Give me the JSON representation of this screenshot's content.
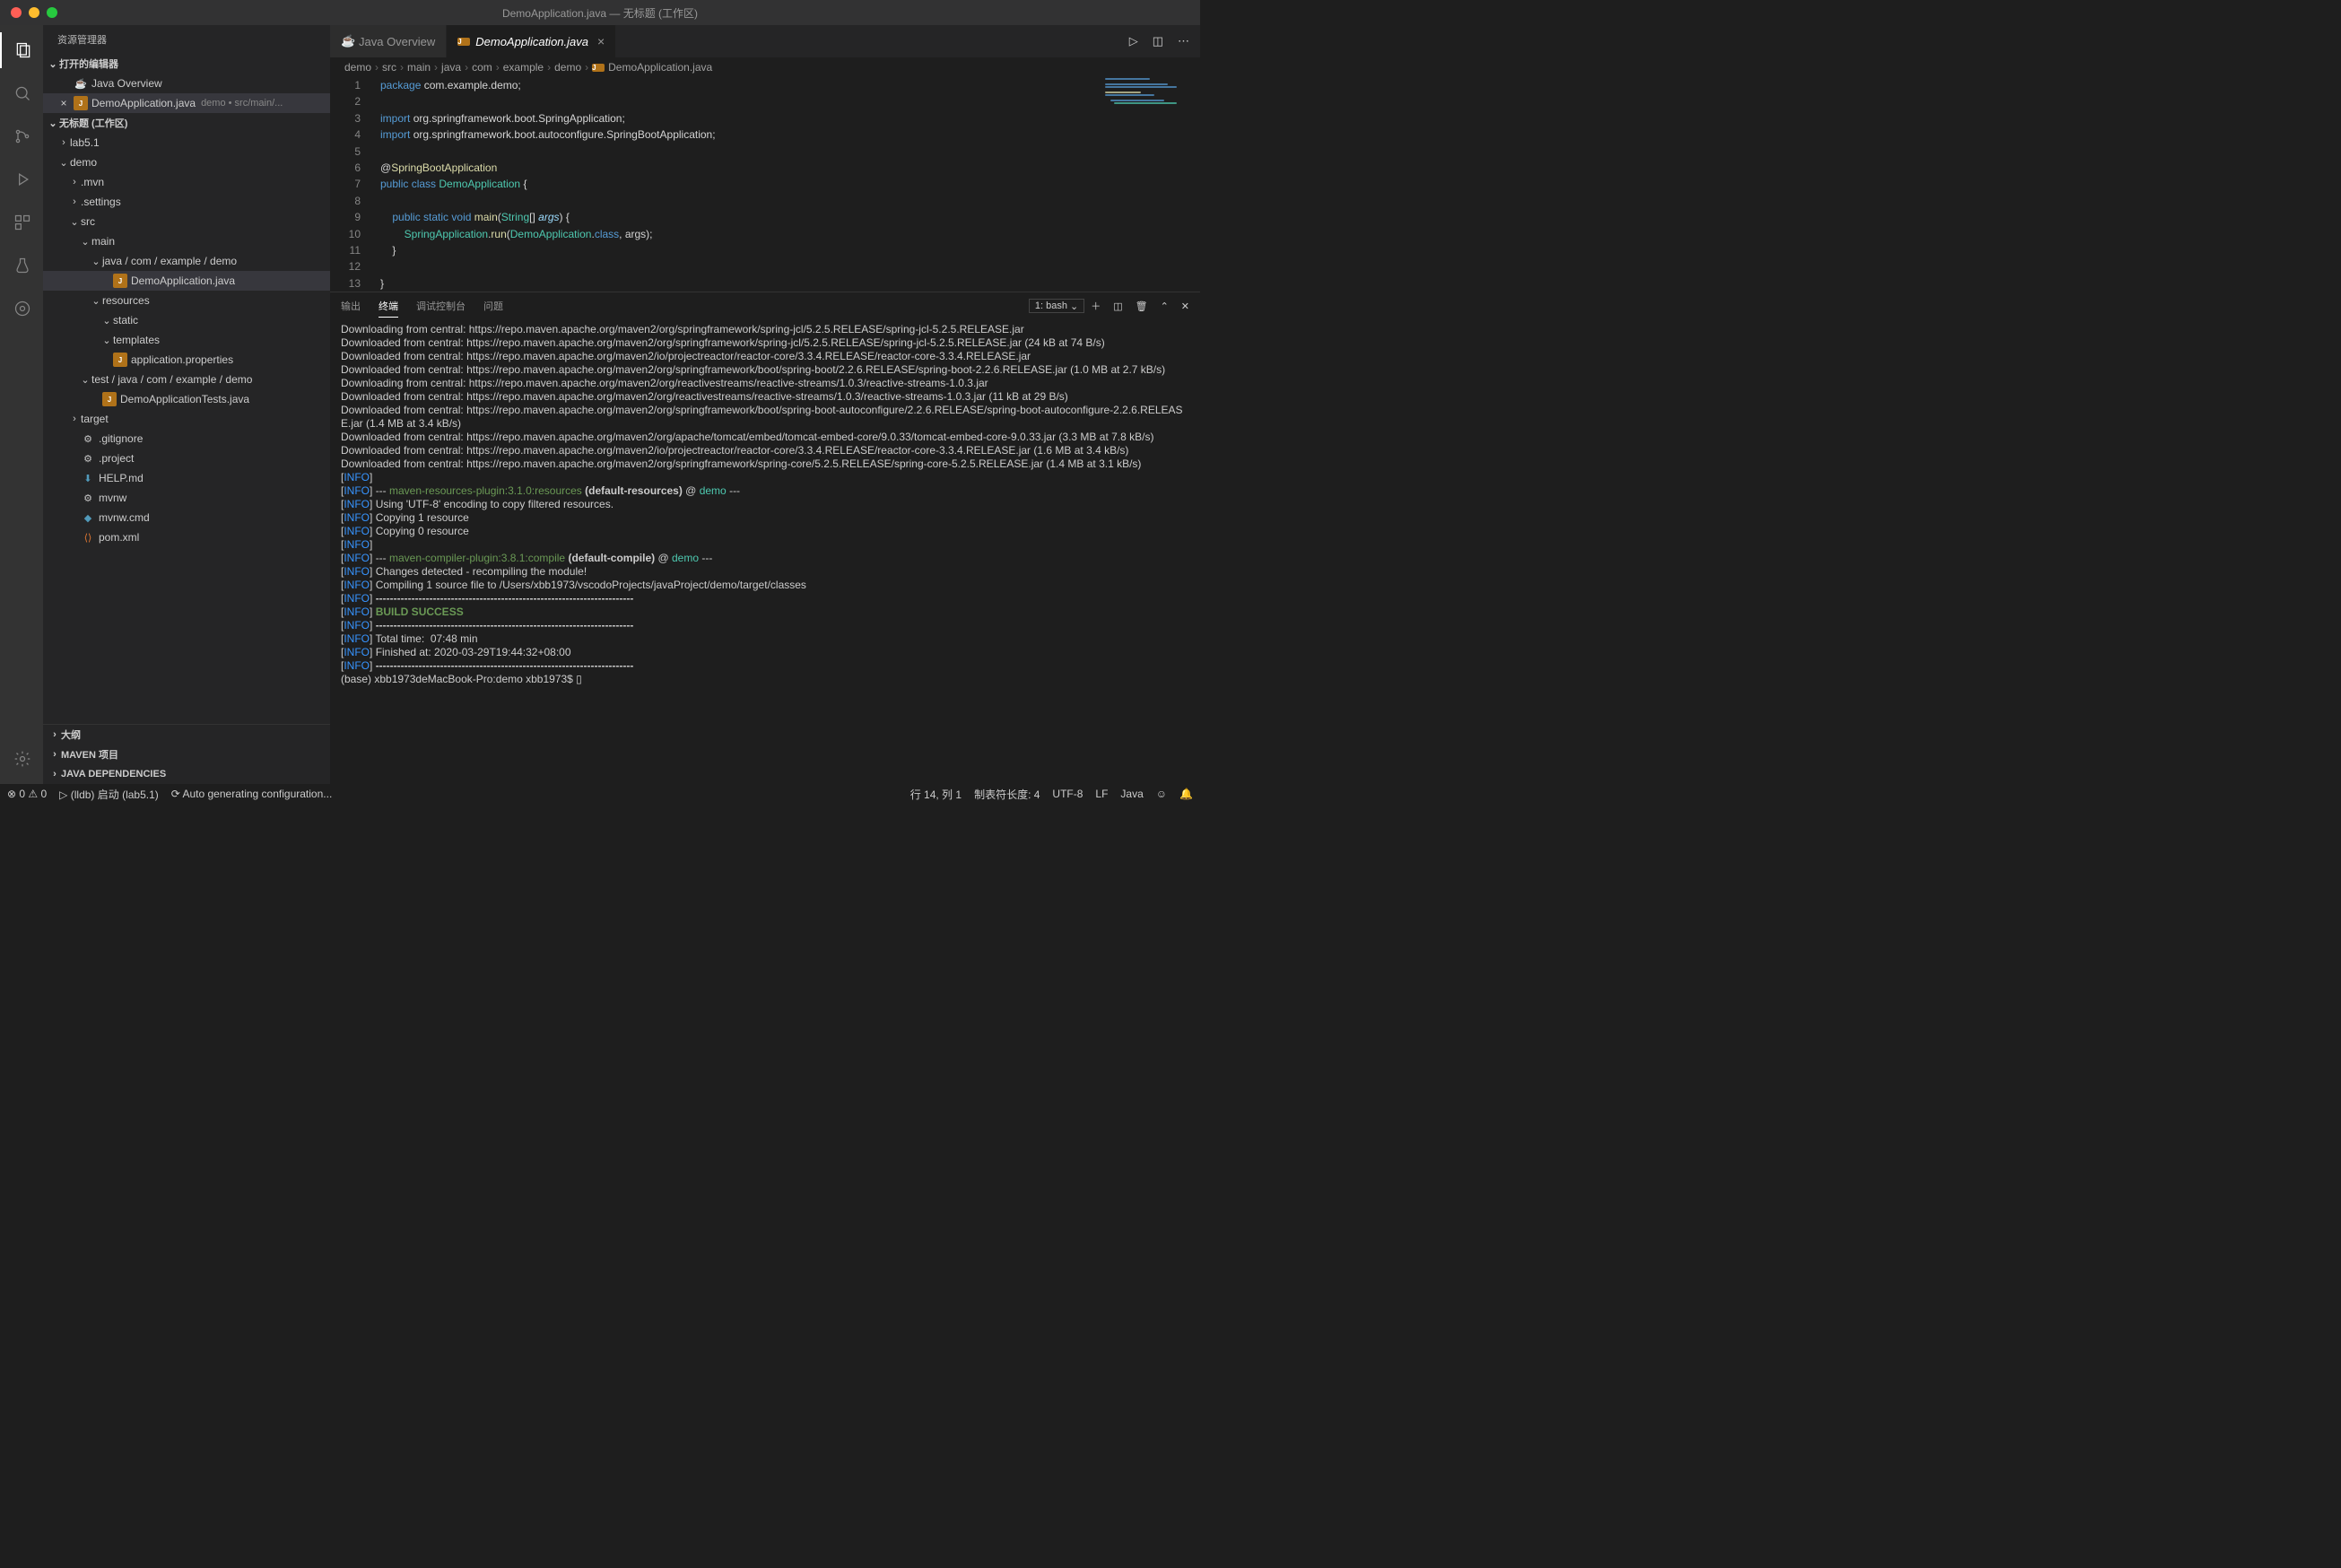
{
  "window": {
    "title": "DemoApplication.java — 无标题 (工作区)"
  },
  "sidebar": {
    "header": "资源管理器",
    "open_editors_title": "打开的编辑器",
    "open_editors": [
      {
        "icon": "jov",
        "label": "Java Overview",
        "meta": ""
      },
      {
        "icon": "java",
        "label": "DemoApplication.java",
        "meta": "demo • src/main/...",
        "closable": true,
        "active": true
      }
    ],
    "workspace_title": "无标题 (工作区)",
    "tree": [
      {
        "d": 1,
        "t": "f",
        "open": false,
        "label": "lab5.1"
      },
      {
        "d": 1,
        "t": "f",
        "open": true,
        "label": "demo"
      },
      {
        "d": 2,
        "t": "f",
        "open": false,
        "label": ".mvn"
      },
      {
        "d": 2,
        "t": "f",
        "open": false,
        "label": ".settings"
      },
      {
        "d": 2,
        "t": "f",
        "open": true,
        "label": "src"
      },
      {
        "d": 3,
        "t": "f",
        "open": true,
        "label": "main"
      },
      {
        "d": 4,
        "t": "f",
        "open": true,
        "label": "java / com / example / demo"
      },
      {
        "d": 5,
        "t": "file",
        "icon": "java",
        "label": "DemoApplication.java",
        "sel": true
      },
      {
        "d": 4,
        "t": "f",
        "open": true,
        "label": "resources"
      },
      {
        "d": 5,
        "t": "f",
        "open": true,
        "label": "static"
      },
      {
        "d": 5,
        "t": "f",
        "open": true,
        "label": "templates"
      },
      {
        "d": 5,
        "t": "file",
        "icon": "java",
        "label": "application.properties"
      },
      {
        "d": 3,
        "t": "f",
        "open": true,
        "label": "test / java / com / example / demo"
      },
      {
        "d": 4,
        "t": "file",
        "icon": "java",
        "label": "DemoApplicationTests.java"
      },
      {
        "d": 2,
        "t": "f",
        "open": false,
        "label": "target"
      },
      {
        "d": 2,
        "t": "file",
        "icon": "prop",
        "label": ".gitignore"
      },
      {
        "d": 2,
        "t": "file",
        "icon": "prop",
        "label": ".project"
      },
      {
        "d": 2,
        "t": "file",
        "icon": "md",
        "label": "HELP.md"
      },
      {
        "d": 2,
        "t": "file",
        "icon": "prop",
        "label": "mvnw"
      },
      {
        "d": 2,
        "t": "file",
        "icon": "ms",
        "label": "mvnw.cmd"
      },
      {
        "d": 2,
        "t": "file",
        "icon": "xml",
        "label": "pom.xml"
      }
    ],
    "bottom": [
      "大纲",
      "MAVEN 项目",
      "JAVA DEPENDENCIES"
    ]
  },
  "tabs": [
    {
      "icon": "jov",
      "label": "Java Overview",
      "active": false
    },
    {
      "icon": "java",
      "label": "DemoApplication.java",
      "active": true,
      "closable": true
    }
  ],
  "breadcrumb": [
    "demo",
    "src",
    "main",
    "java",
    "com",
    "example",
    "demo",
    "DemoApplication.java"
  ],
  "code_lines": 13,
  "panel": {
    "tabs": [
      "输出",
      "终端",
      "调试控制台",
      "问题"
    ],
    "active_tab": 1,
    "shell": "1: bash"
  },
  "terminal_lines": [
    {
      "txt": "Downloading from central: https://repo.maven.apache.org/maven2/org/springframework/spring-jcl/5.2.5.RELEASE/spring-jcl-5.2.5.RELEASE.jar"
    },
    {
      "txt": "Downloaded from central: https://repo.maven.apache.org/maven2/org/springframework/spring-jcl/5.2.5.RELEASE/spring-jcl-5.2.5.RELEASE.jar (24 kB at 74 B/s)"
    },
    {
      "txt": "Downloaded from central: https://repo.maven.apache.org/maven2/io/projectreactor/reactor-core/3.3.4.RELEASE/reactor-core-3.3.4.RELEASE.jar"
    },
    {
      "txt": "Downloaded from central: https://repo.maven.apache.org/maven2/org/springframework/boot/spring-boot/2.2.6.RELEASE/spring-boot-2.2.6.RELEASE.jar (1.0 MB at 2.7 kB/s)"
    },
    {
      "txt": "Downloading from central: https://repo.maven.apache.org/maven2/org/reactivestreams/reactive-streams/1.0.3/reactive-streams-1.0.3.jar"
    },
    {
      "txt": "Downloaded from central: https://repo.maven.apache.org/maven2/org/reactivestreams/reactive-streams/1.0.3/reactive-streams-1.0.3.jar (11 kB at 29 B/s)"
    },
    {
      "txt": "Downloaded from central: https://repo.maven.apache.org/maven2/org/springframework/boot/spring-boot-autoconfigure/2.2.6.RELEASE/spring-boot-autoconfigure-2.2.6.RELEASE.jar (1.4 MB at 3.4 kB/s)"
    },
    {
      "txt": "Downloaded from central: https://repo.maven.apache.org/maven2/org/apache/tomcat/embed/tomcat-embed-core/9.0.33/tomcat-embed-core-9.0.33.jar (3.3 MB at 7.8 kB/s)"
    },
    {
      "txt": "Downloaded from central: https://repo.maven.apache.org/maven2/io/projectreactor/reactor-core/3.3.4.RELEASE/reactor-core-3.3.4.RELEASE.jar (1.6 MB at 3.4 kB/s)"
    },
    {
      "txt": "Downloaded from central: https://repo.maven.apache.org/maven2/org/springframework/spring-core/5.2.5.RELEASE/spring-core-5.2.5.RELEASE.jar (1.4 MB at 3.1 kB/s)"
    },
    {
      "info": true,
      "txt": ""
    },
    {
      "info": true,
      "run": [
        {
          "c": "p",
          "t": "--- "
        },
        {
          "c": "g",
          "t": "maven-resources-plugin:3.1.0:resources"
        },
        {
          "c": "p",
          "t": " "
        },
        {
          "c": "bold",
          "t": "(default-resources)"
        },
        {
          "c": "p",
          "t": " @ "
        },
        {
          "c": "cy",
          "t": "demo"
        },
        {
          "c": "p",
          "t": " ---"
        }
      ]
    },
    {
      "info": true,
      "txt": "Using 'UTF-8' encoding to copy filtered resources."
    },
    {
      "info": true,
      "txt": "Copying 1 resource"
    },
    {
      "info": true,
      "txt": "Copying 0 resource"
    },
    {
      "info": true,
      "txt": ""
    },
    {
      "info": true,
      "run": [
        {
          "c": "p",
          "t": "--- "
        },
        {
          "c": "g",
          "t": "maven-compiler-plugin:3.8.1:compile"
        },
        {
          "c": "p",
          "t": " "
        },
        {
          "c": "bold",
          "t": "(default-compile)"
        },
        {
          "c": "p",
          "t": " @ "
        },
        {
          "c": "cy",
          "t": "demo"
        },
        {
          "c": "p",
          "t": " ---"
        }
      ]
    },
    {
      "info": true,
      "txt": "Changes detected - recompiling the module!"
    },
    {
      "info": true,
      "txt": "Compiling 1 source file to /Users/xbb1973/vscodoProjects/javaProject/demo/target/classes"
    },
    {
      "info": true,
      "run": [
        {
          "c": "bold",
          "t": "------------------------------------------------------------------------"
        }
      ]
    },
    {
      "info": true,
      "run": [
        {
          "c": "g bold",
          "t": "BUILD SUCCESS"
        }
      ]
    },
    {
      "info": true,
      "run": [
        {
          "c": "bold",
          "t": "------------------------------------------------------------------------"
        }
      ]
    },
    {
      "info": true,
      "txt": "Total time:  07:48 min"
    },
    {
      "info": true,
      "txt": "Finished at: 2020-03-29T19:44:32+08:00"
    },
    {
      "info": true,
      "run": [
        {
          "c": "bold",
          "t": "------------------------------------------------------------------------"
        }
      ]
    },
    {
      "txt": "(base) xbb1973deMacBook-Pro:demo xbb1973$ ▯"
    }
  ],
  "status": {
    "left": [
      "⊗ 0 ⚠ 0",
      "▷ (lldb) 启动 (lab5.1)",
      "⟳ Auto generating configuration..."
    ],
    "right": [
      "行 14, 列 1",
      "制表符长度: 4",
      "UTF-8",
      "LF",
      "Java",
      "☺",
      "🔔"
    ]
  }
}
